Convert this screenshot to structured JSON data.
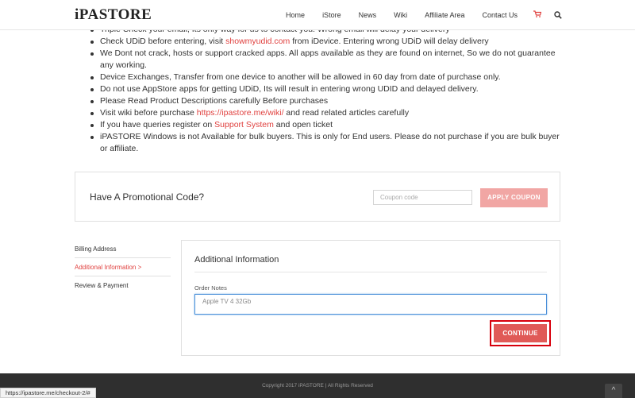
{
  "header": {
    "logo": "iPASTORE",
    "nav": [
      "Home",
      "iStore",
      "News",
      "Wiki",
      "Affiliate Area",
      "Contact Us"
    ],
    "cart_icon": "cart-icon",
    "search_icon": "search-icon"
  },
  "notes": {
    "items": [
      {
        "pre": "Triple Check your email, Its only way for us to contact you. Wrong email will delay your delivery",
        "link": "",
        "post": ""
      },
      {
        "pre": "Check UDiD before entering, visit ",
        "link": "showmyudid.com",
        "post": " from iDevice. Entering wrong UDiD will delay delivery"
      },
      {
        "pre": "We Dont not crack, hosts or support cracked apps. All apps available as they are found on internet, So we do not guarantee any working.",
        "link": "",
        "post": ""
      },
      {
        "pre": "Device Exchanges, Transfer from one device to another will be allowed in 60 day from date of purchase only.",
        "link": "",
        "post": ""
      },
      {
        "pre": "Do not use AppStore apps for getting UDiD, Its will result in entering wrong UDID and delayed delivery.",
        "link": "",
        "post": ""
      },
      {
        "pre": "Please Read Product Descriptions carefully Before purchases",
        "link": "",
        "post": ""
      },
      {
        "pre": "Visit wiki before purchase ",
        "link": "https://ipastore.me/wiki/",
        "post": " and read related articles carefully"
      },
      {
        "pre": "If you have queries register on ",
        "link": "Support System",
        "post": " and open ticket"
      },
      {
        "pre": "iPASTORE Windows is not Available for bulk buyers. This is only for End users. Please do not purchase if you are bulk buyer or affiliate.",
        "link": "",
        "post": ""
      }
    ]
  },
  "promo": {
    "title": "Have A Promotional Code?",
    "placeholder": "Coupon code",
    "button": "APPLY COUPON"
  },
  "steps": {
    "billing": "Billing Address",
    "additional": "Additional Information >",
    "review": "Review & Payment"
  },
  "panel": {
    "title": "Additional Information",
    "notes_label": "Order Notes",
    "notes_value": "Apple TV 4 32Gb",
    "continue": "CONTINUE"
  },
  "footer": {
    "copyright": "Copyright 2017 iPASTORE | All Rights Reserved",
    "to_top": "^"
  },
  "status_url": "https://ipastore.me/checkout-2/#",
  "colors": {
    "accent": "#e0413f",
    "button": "#e05a57",
    "button_light": "#f1a6a4",
    "highlight": "#d8000c",
    "footer": "#2f2f2f"
  }
}
